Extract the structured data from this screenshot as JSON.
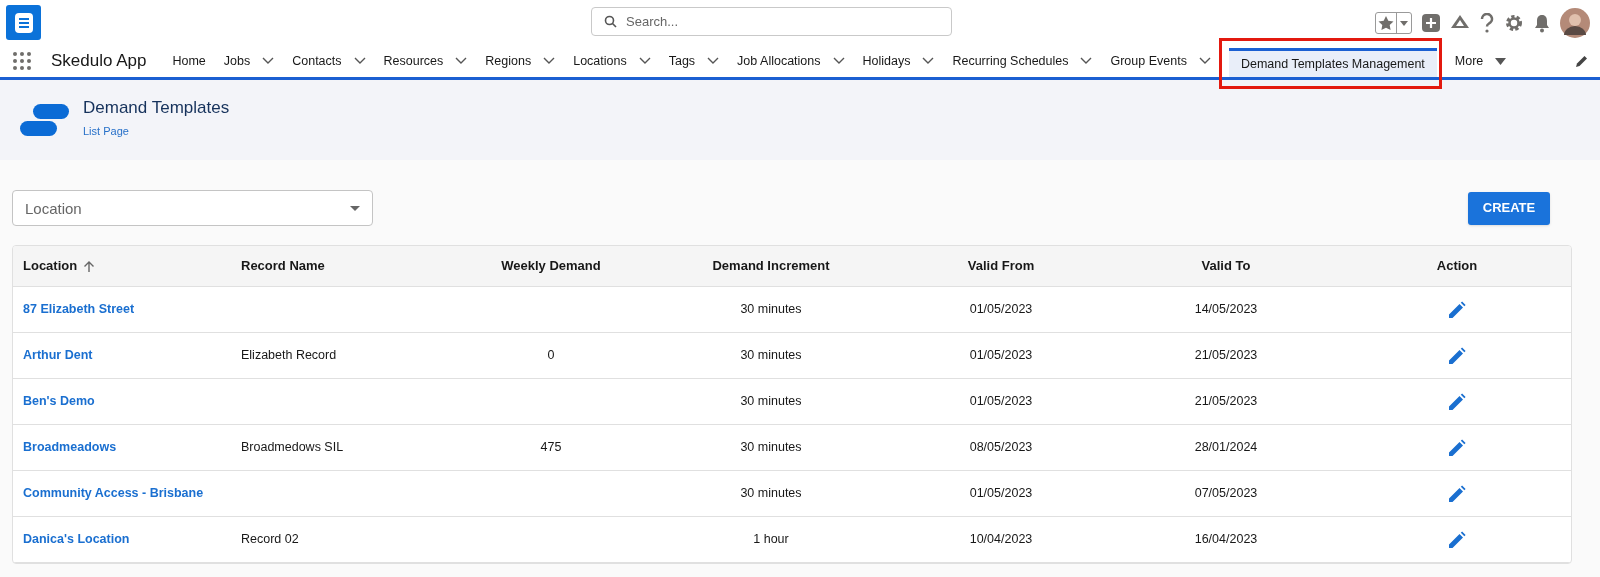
{
  "search": {
    "placeholder": "Search..."
  },
  "app_name": "Skedulo App",
  "nav": [
    {
      "label": "Home",
      "kind": "link",
      "selected": false
    },
    {
      "label": "Jobs",
      "kind": "menu",
      "selected": false
    },
    {
      "label": "Contacts",
      "kind": "menu",
      "selected": false
    },
    {
      "label": "Resources",
      "kind": "menu",
      "selected": false
    },
    {
      "label": "Regions",
      "kind": "menu",
      "selected": false
    },
    {
      "label": "Locations",
      "kind": "menu",
      "selected": false
    },
    {
      "label": "Tags",
      "kind": "menu",
      "selected": false
    },
    {
      "label": "Job Allocations",
      "kind": "menu",
      "selected": false
    },
    {
      "label": "Holidays",
      "kind": "menu",
      "selected": false
    },
    {
      "label": "Recurring Schedules",
      "kind": "menu",
      "selected": false
    },
    {
      "label": "Group Events",
      "kind": "menu",
      "selected": false
    },
    {
      "label": "Demand Templates Management",
      "kind": "link",
      "selected": true
    },
    {
      "label": "More",
      "kind": "more",
      "selected": false
    }
  ],
  "page_header": {
    "title": "Demand Templates",
    "subtitle": "List Page"
  },
  "filter": {
    "placeholder": "Location"
  },
  "create_button": "CREATE",
  "table": {
    "columns": [
      {
        "label": "Location",
        "sorted": true
      },
      {
        "label": "Record Name",
        "sorted": false
      },
      {
        "label": "Weekly Demand",
        "sorted": false
      },
      {
        "label": "Demand Increment",
        "sorted": false
      },
      {
        "label": "Valid From",
        "sorted": false
      },
      {
        "label": "Valid To",
        "sorted": false
      },
      {
        "label": "Action",
        "sorted": false
      }
    ],
    "rows": [
      {
        "location": "87 Elizabeth Street",
        "record_name": "",
        "weekly_demand": "",
        "demand_increment": "30 minutes",
        "valid_from": "01/05/2023",
        "valid_to": "14/05/2023"
      },
      {
        "location": "Arthur Dent",
        "record_name": "Elizabeth Record",
        "weekly_demand": "0",
        "demand_increment": "30 minutes",
        "valid_from": "01/05/2023",
        "valid_to": "21/05/2023"
      },
      {
        "location": "Ben's Demo",
        "record_name": "",
        "weekly_demand": "",
        "demand_increment": "30 minutes",
        "valid_from": "01/05/2023",
        "valid_to": "21/05/2023"
      },
      {
        "location": "Broadmeadows",
        "record_name": "Broadmedows SIL",
        "weekly_demand": "475",
        "demand_increment": "30 minutes",
        "valid_from": "08/05/2023",
        "valid_to": "28/01/2024"
      },
      {
        "location": "Community Access - Brisbane",
        "record_name": "",
        "weekly_demand": "",
        "demand_increment": "30 minutes",
        "valid_from": "01/05/2023",
        "valid_to": "07/05/2023"
      },
      {
        "location": "Danica's Location",
        "record_name": "Record 02",
        "weekly_demand": "",
        "demand_increment": "1 hour",
        "valid_from": "10/04/2023",
        "valid_to": "16/04/2023"
      }
    ]
  }
}
